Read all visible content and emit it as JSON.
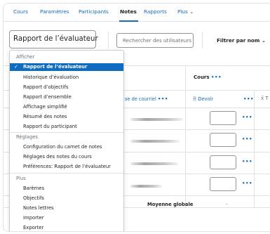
{
  "tabs": [
    {
      "label": "Cours"
    },
    {
      "label": "Paramètres"
    },
    {
      "label": "Participants"
    },
    {
      "label": "Notes",
      "active": true
    },
    {
      "label": "Rapports"
    },
    {
      "label": "Plus"
    }
  ],
  "toolbar": {
    "report_select": "Rapport de l’évaluateur",
    "search_placeholder": "Rechercher des utilisateurs",
    "filter_label": "Filtrer par nom"
  },
  "table": {
    "course_header": "Cours",
    "email_header": "se de courriel",
    "assignment_header": "Devoir",
    "total_header": "T",
    "overall_average_label": "Moyenne globale",
    "overall_average_value": "-",
    "menu_dots": "•••"
  },
  "menu": {
    "sections": [
      {
        "label": "Afficher",
        "items": [
          {
            "label": "Rapport de l’évaluateur",
            "selected": true
          },
          {
            "label": "Historique d’évaluation"
          },
          {
            "label": "Rapport d’objectifs"
          },
          {
            "label": "Rapport d’ensemble"
          },
          {
            "label": "Affichage simplifié"
          },
          {
            "label": "Résumé des notes"
          },
          {
            "label": "Rapport du participant"
          }
        ]
      },
      {
        "label": "Réglages",
        "items": [
          {
            "label": "Configuration du carnet de notes"
          },
          {
            "label": "Réglages des notes du cours"
          },
          {
            "label": "Préférences: Rapport de l’évaluateur"
          }
        ]
      },
      {
        "label": "Plus",
        "items": [
          {
            "label": "Barèmes"
          },
          {
            "label": "Objectifs"
          },
          {
            "label": "Notes lettres"
          },
          {
            "label": "Importer"
          },
          {
            "label": "Exporter"
          }
        ]
      }
    ]
  },
  "colors": {
    "accent": "#0f6cbf",
    "text": "#1d2125",
    "border": "#dee2e6"
  }
}
